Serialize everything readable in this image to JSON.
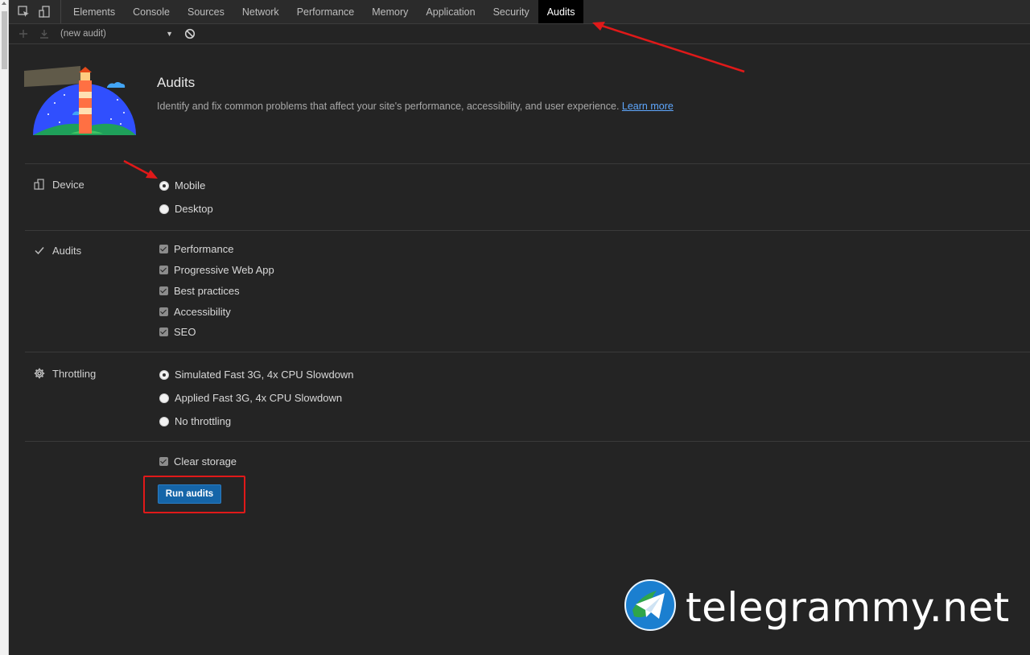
{
  "tabs": [
    {
      "label": "Elements"
    },
    {
      "label": "Console"
    },
    {
      "label": "Sources"
    },
    {
      "label": "Network"
    },
    {
      "label": "Performance"
    },
    {
      "label": "Memory"
    },
    {
      "label": "Application"
    },
    {
      "label": "Security"
    },
    {
      "label": "Audits",
      "active": true
    }
  ],
  "toolbar": {
    "audit_select": "(new audit)"
  },
  "header": {
    "title": "Audits",
    "description": "Identify and fix common problems that affect your site's performance, accessibility, and user experience.",
    "learn_more": "Learn more"
  },
  "device": {
    "label": "Device",
    "options": [
      {
        "label": "Mobile",
        "checked": true
      },
      {
        "label": "Desktop",
        "checked": false
      }
    ]
  },
  "audits": {
    "label": "Audits",
    "options": [
      {
        "label": "Performance",
        "checked": true
      },
      {
        "label": "Progressive Web App",
        "checked": true
      },
      {
        "label": "Best practices",
        "checked": true
      },
      {
        "label": "Accessibility",
        "checked": true
      },
      {
        "label": "SEO",
        "checked": true
      }
    ]
  },
  "throttling": {
    "label": "Throttling",
    "options": [
      {
        "label": "Simulated Fast 3G, 4x CPU Slowdown",
        "checked": true
      },
      {
        "label": "Applied Fast 3G, 4x CPU Slowdown",
        "checked": false
      },
      {
        "label": "No throttling",
        "checked": false
      }
    ]
  },
  "clear_storage": {
    "label": "Clear storage",
    "checked": true
  },
  "run_button": "Run audits",
  "watermark": "telegrammy.net",
  "colors": {
    "active_tab_bg": "#000000",
    "run_button": "#1565a8",
    "annotation_red": "#e01919",
    "link": "#5fa8ff"
  }
}
